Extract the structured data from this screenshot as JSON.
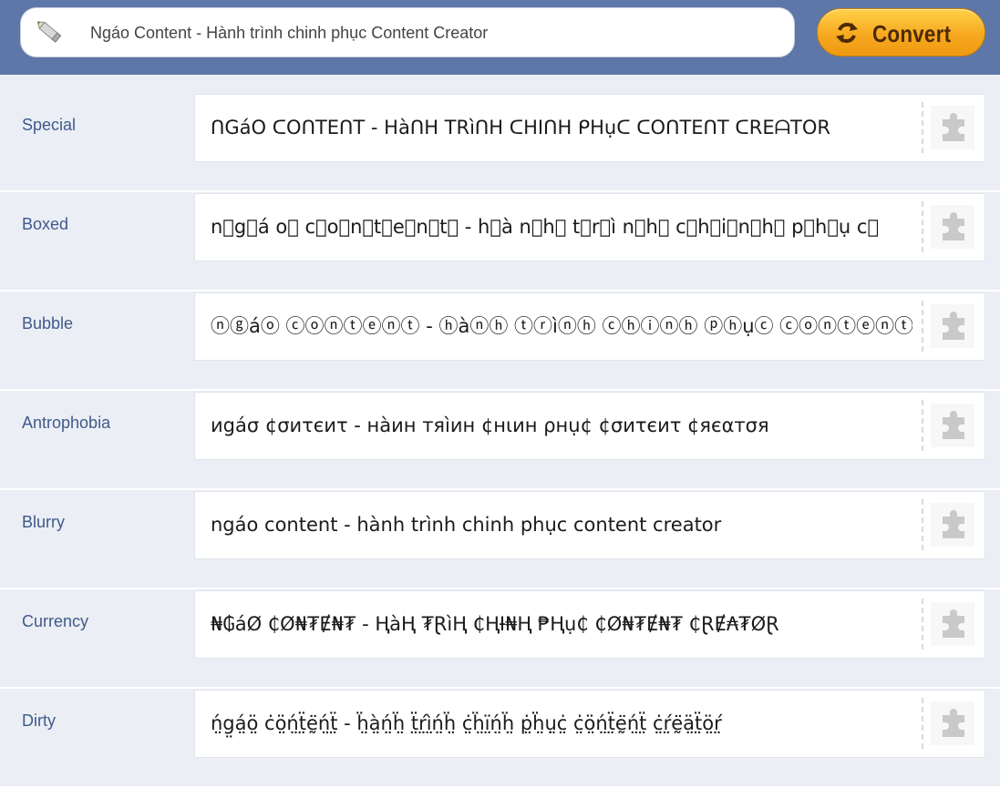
{
  "search": {
    "value": "Ngáo Content - Hành trình chinh phục Content Creator"
  },
  "convert_button": {
    "label": "Convert"
  },
  "styles": [
    {
      "name": "Special",
      "output": "ᑎGáO ᑕOᑎTEᑎT - HàᑎH TRìᑎH ᑕHIᑎH ᑭHụᑕ ᑕOᑎTEᑎT ᑕREᗩTOR"
    },
    {
      "name": "Boxed",
      "output": "n⃞g⃞á o⃞ c⃞o⃞n⃞t⃞e⃞n⃞t⃞ - h⃞à n⃞h⃞ t⃞r⃞ì n⃞h⃞ c⃞h⃞i⃞n⃞h⃞ p⃞h⃞ụ c⃞"
    },
    {
      "name": "Bubble",
      "output": "ⓝⓖáⓞ ⓒⓞⓝⓣⓔⓝⓣ - ⓗàⓝⓗ ⓣⓡìⓝⓗ ⓒⓗⓘⓝⓗ ⓟⓗụⓒ ⓒⓞⓝⓣⓔⓝⓣ ⓒⓡⓔⓐⓣⓞⓡ"
    },
    {
      "name": "Antrophobia",
      "output": "иgáσ ¢σиτєиτ - нàин тяìин ¢нιин ρнụ¢ ¢σиτєиτ ¢яєαтσя"
    },
    {
      "name": "Blurry",
      "output": "ngáo content - hành trình chinh phục content creator"
    },
    {
      "name": "Currency",
      "output": "₦₲áØ ₵Ø₦₮Ɇ₦₮ - ⱧàⱧ ₮ⱤìⱧ ₵ⱧƗ₦Ⱨ ₱Ⱨụ₵ ₵Ø₦₮Ɇ₦₮ ₵ⱤɆ₳₮ØⱤ"
    },
    {
      "name": "Dirty",
      "output": "ń̤g̤á̤ö̤ ċö̤ń̤ẗ̤ḛ̈ń̤ẗ̤ - ḧ̤à̤ń̤ḧ̤ ẗ̤ŕ̤ì̤ń̤ḧ̤ ċ̤ḧ̤ï̤ń̤ḧ̤ ṗ̤ḧ̤ụ̤ċ̤ ċ̤ö̤ń̤ẗ̤ḛ̈ń̤ẗ̤ ċ̤ŕ̤ḛ̈ä̤ẗ̤ö̤ŕ̤"
    }
  ],
  "colors": {
    "topbar": "#5c77a8",
    "label": "#3f5a8c",
    "button": "#f6a81f"
  }
}
